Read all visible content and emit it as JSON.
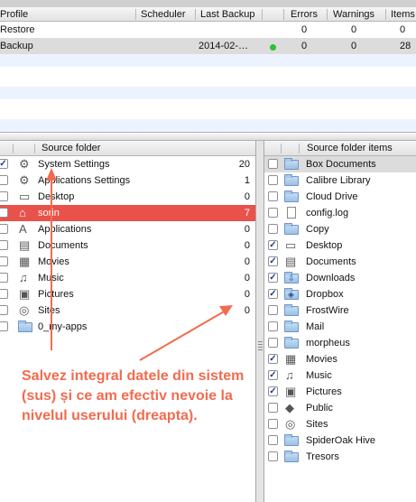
{
  "profiles_table": {
    "headers": {
      "profile": "Profile",
      "scheduler": "Scheduler",
      "last_backup": "Last Backup",
      "errors": "Errors",
      "warnings": "Warnings",
      "items": "Items"
    },
    "rows": [
      {
        "profile": "Restore",
        "scheduler": "",
        "last_backup": "",
        "errors": "0",
        "warnings": "0",
        "items": "0",
        "selected": false
      },
      {
        "profile": "Backup",
        "scheduler": "",
        "last_backup": "2014-02-…",
        "errors": "0",
        "warnings": "0",
        "items": "28",
        "selected": true,
        "status_color": "#2fbf2f"
      }
    ]
  },
  "source_folder_panel": {
    "header": "Source folder",
    "items": [
      {
        "label": "System Settings",
        "count": "20",
        "checked": true,
        "icon": "system-settings-icon"
      },
      {
        "label": "Applications Settings",
        "count": "1",
        "checked": false,
        "icon": "app-settings-icon"
      },
      {
        "label": "Desktop",
        "count": "0",
        "checked": false,
        "icon": "desktop-icon"
      },
      {
        "label": "sorin",
        "count": "7",
        "checked": false,
        "icon": "home-icon",
        "selected": true
      },
      {
        "label": "Applications",
        "count": "0",
        "checked": false,
        "icon": "applications-icon"
      },
      {
        "label": "Documents",
        "count": "0",
        "checked": false,
        "icon": "documents-icon"
      },
      {
        "label": "Movies",
        "count": "0",
        "checked": false,
        "icon": "movies-icon"
      },
      {
        "label": "Music",
        "count": "0",
        "checked": false,
        "icon": "music-icon"
      },
      {
        "label": "Pictures",
        "count": "0",
        "checked": false,
        "icon": "pictures-icon"
      },
      {
        "label": "Sites",
        "count": "0",
        "checked": false,
        "icon": "sites-icon"
      },
      {
        "label": "0_my-apps",
        "count": "",
        "checked": false,
        "icon": "folder-icon"
      }
    ]
  },
  "source_items_panel": {
    "header": "Source folder items",
    "items": [
      {
        "label": "Box Documents",
        "checked": false,
        "icon": "folder-icon",
        "highlighted": true
      },
      {
        "label": "Calibre Library",
        "checked": false,
        "icon": "folder-icon"
      },
      {
        "label": "Cloud Drive",
        "checked": false,
        "icon": "folder-icon"
      },
      {
        "label": "config.log",
        "checked": false,
        "icon": "file-icon"
      },
      {
        "label": "Copy",
        "checked": false,
        "icon": "folder-icon"
      },
      {
        "label": "Desktop",
        "checked": true,
        "icon": "desktop-icon"
      },
      {
        "label": "Documents",
        "checked": true,
        "icon": "documents-icon"
      },
      {
        "label": "Downloads",
        "checked": true,
        "icon": "downloads-icon"
      },
      {
        "label": "Dropbox",
        "checked": true,
        "icon": "dropbox-icon"
      },
      {
        "label": "FrostWire",
        "checked": false,
        "icon": "folder-icon"
      },
      {
        "label": "Mail",
        "checked": false,
        "icon": "folder-icon"
      },
      {
        "label": "morpheus",
        "checked": false,
        "icon": "folder-icon"
      },
      {
        "label": "Movies",
        "checked": true,
        "icon": "movies-icon"
      },
      {
        "label": "Music",
        "checked": true,
        "icon": "music-icon"
      },
      {
        "label": "Pictures",
        "checked": true,
        "icon": "pictures-icon"
      },
      {
        "label": "Public",
        "checked": false,
        "icon": "public-icon"
      },
      {
        "label": "Sites",
        "checked": false,
        "icon": "sites-icon"
      },
      {
        "label": "SpiderOak Hive",
        "checked": false,
        "icon": "folder-icon"
      },
      {
        "label": "Tresors",
        "checked": false,
        "icon": "folder-icon"
      }
    ]
  },
  "annotation": {
    "text": "Salvez integral datele din sistem (sus) și ce am efectiv nevoie la nivelul userului (dreapta).",
    "color": "#f26b4f"
  },
  "colors": {
    "selected_row": "#e8524a",
    "accent": "#f26b4f"
  }
}
